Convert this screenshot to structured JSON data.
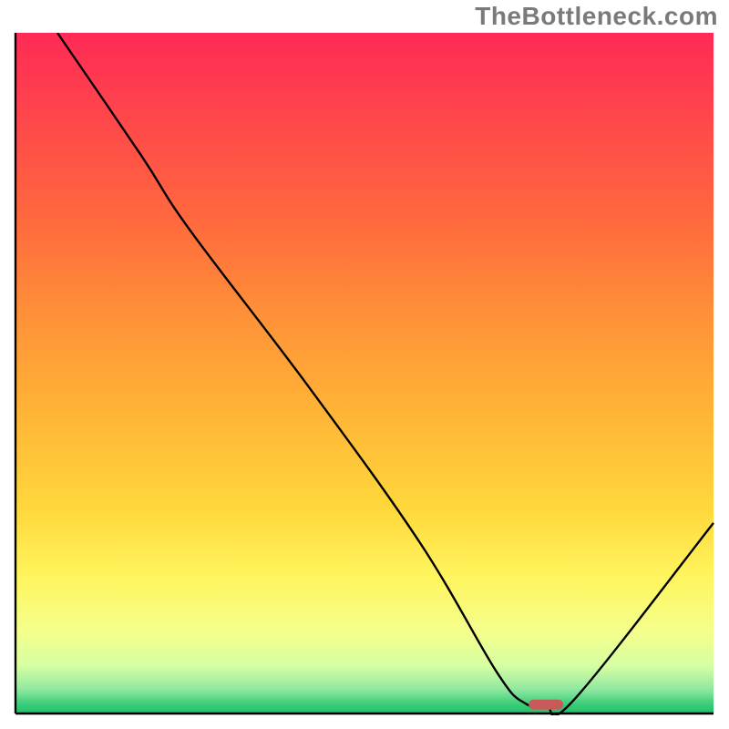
{
  "watermark": "TheBottleneck.com",
  "chart_data": {
    "type": "line",
    "title": "",
    "xlabel": "",
    "ylabel": "",
    "xlim": [
      0,
      100
    ],
    "ylim": [
      0,
      100
    ],
    "series": [
      {
        "name": "bottleneck-curve",
        "x": [
          6,
          18,
          25,
          42,
          58,
          69,
          73,
          76,
          80,
          100
        ],
        "values": [
          100,
          82,
          71,
          48,
          25,
          6,
          1.5,
          1.2,
          2,
          28
        ]
      }
    ],
    "annotations": [
      {
        "name": "optimal-marker",
        "x": 76,
        "y": 1.3,
        "shape": "pill",
        "color": "#c85a5a"
      }
    ],
    "gradient_stops": [
      {
        "offset": 0.0,
        "color": "#ff2a55"
      },
      {
        "offset": 0.14,
        "color": "#ff4a4a"
      },
      {
        "offset": 0.28,
        "color": "#ff6a3d"
      },
      {
        "offset": 0.42,
        "color": "#ff9238"
      },
      {
        "offset": 0.56,
        "color": "#ffb536"
      },
      {
        "offset": 0.7,
        "color": "#ffd83c"
      },
      {
        "offset": 0.8,
        "color": "#fff55e"
      },
      {
        "offset": 0.88,
        "color": "#f4ff8c"
      },
      {
        "offset": 0.93,
        "color": "#d6ffa3"
      },
      {
        "offset": 0.965,
        "color": "#8fe8a0"
      },
      {
        "offset": 0.985,
        "color": "#3ecf7a"
      },
      {
        "offset": 1.0,
        "color": "#1fbf6b"
      }
    ]
  },
  "colors": {
    "watermark": "#7a7a7a",
    "axis": "#000000",
    "curve": "#000000",
    "marker": "#c85a5a"
  }
}
